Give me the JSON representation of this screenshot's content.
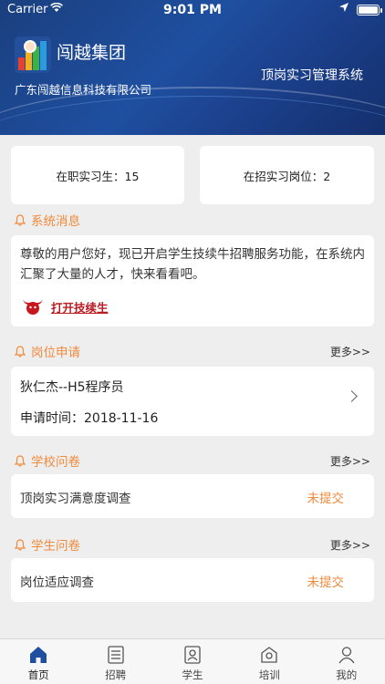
{
  "status_bar": {
    "carrier": "Carrier",
    "time": "9:01 PM"
  },
  "header": {
    "brand_name": "闯越集团",
    "company": "广东闯越信息科技有限公司",
    "system_name": "顶岗实习管理系统"
  },
  "stats": [
    {
      "label": "在职实习生：15"
    },
    {
      "label": "在招实习岗位：2"
    }
  ],
  "system_notice": {
    "title": "系统消息",
    "text": "尊敬的用户您好，现已开启学生技续牛招聘服务功能，在系统内汇聚了大量的人才，快来看看吧。",
    "link_label": "打开技续生"
  },
  "job_application": {
    "title": "岗位申请",
    "more": "更多>>",
    "item": {
      "line1": "狄仁杰--H5程序员",
      "line2": "申请时间：2018-11-16"
    }
  },
  "school_survey": {
    "title": "学校问卷",
    "more": "更多>>",
    "item": {
      "name": "顶岗实习满意度调查",
      "status": "未提交"
    }
  },
  "student_survey": {
    "title": "学生问卷",
    "more": "更多>>",
    "item": {
      "name": "岗位适应调查",
      "status": "未提交"
    }
  },
  "tabbar": {
    "tabs": [
      {
        "label": "首页",
        "icon": "home-icon",
        "active": true
      },
      {
        "label": "招聘",
        "icon": "list-icon",
        "active": false
      },
      {
        "label": "学生",
        "icon": "student-icon",
        "active": false
      },
      {
        "label": "培训",
        "icon": "training-icon",
        "active": false
      },
      {
        "label": "我的",
        "icon": "profile-icon",
        "active": false
      }
    ]
  },
  "colors": {
    "accent": "#f08a3c",
    "header": "#1f4fa0",
    "link": "#b81c22"
  }
}
